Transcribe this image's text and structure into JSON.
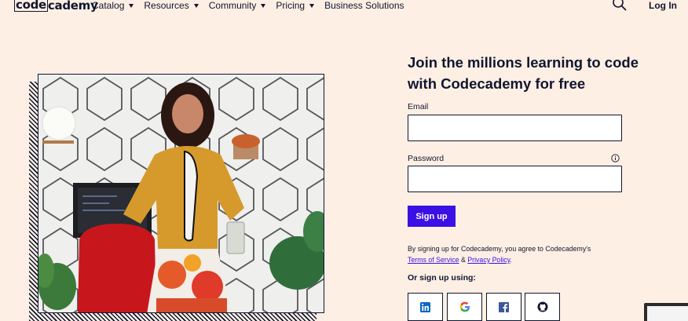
{
  "nav": {
    "logo_left": "code",
    "logo_right": "cademy",
    "items": [
      {
        "label": "Catalog",
        "has_caret": true
      },
      {
        "label": "Resources",
        "has_caret": true
      },
      {
        "label": "Community",
        "has_caret": true
      },
      {
        "label": "Pricing",
        "has_caret": true
      },
      {
        "label": "Business Solutions",
        "has_caret": false
      }
    ],
    "login_label": "Log In",
    "search_icon": "search-icon"
  },
  "signup": {
    "heading": "Join the millions learning to code with Codecademy for free",
    "email_label": "Email",
    "email_value": "",
    "password_label": "Password",
    "password_value": "",
    "info_icon": "info-icon",
    "button_label": "Sign up",
    "terms_prefix": "By signing up for Codecademy, you agree to Codecademy's",
    "terms_link": "Terms of Service",
    "terms_and": " & ",
    "privacy_link": "Privacy Policy",
    "terms_suffix": ".",
    "or_label": "Or sign up using:",
    "providers": [
      "linkedin-icon",
      "google-icon",
      "facebook-icon",
      "github-icon"
    ]
  },
  "colors": {
    "background": "#fdefe4",
    "navy": "#10162f",
    "accent": "#3a10e5"
  }
}
